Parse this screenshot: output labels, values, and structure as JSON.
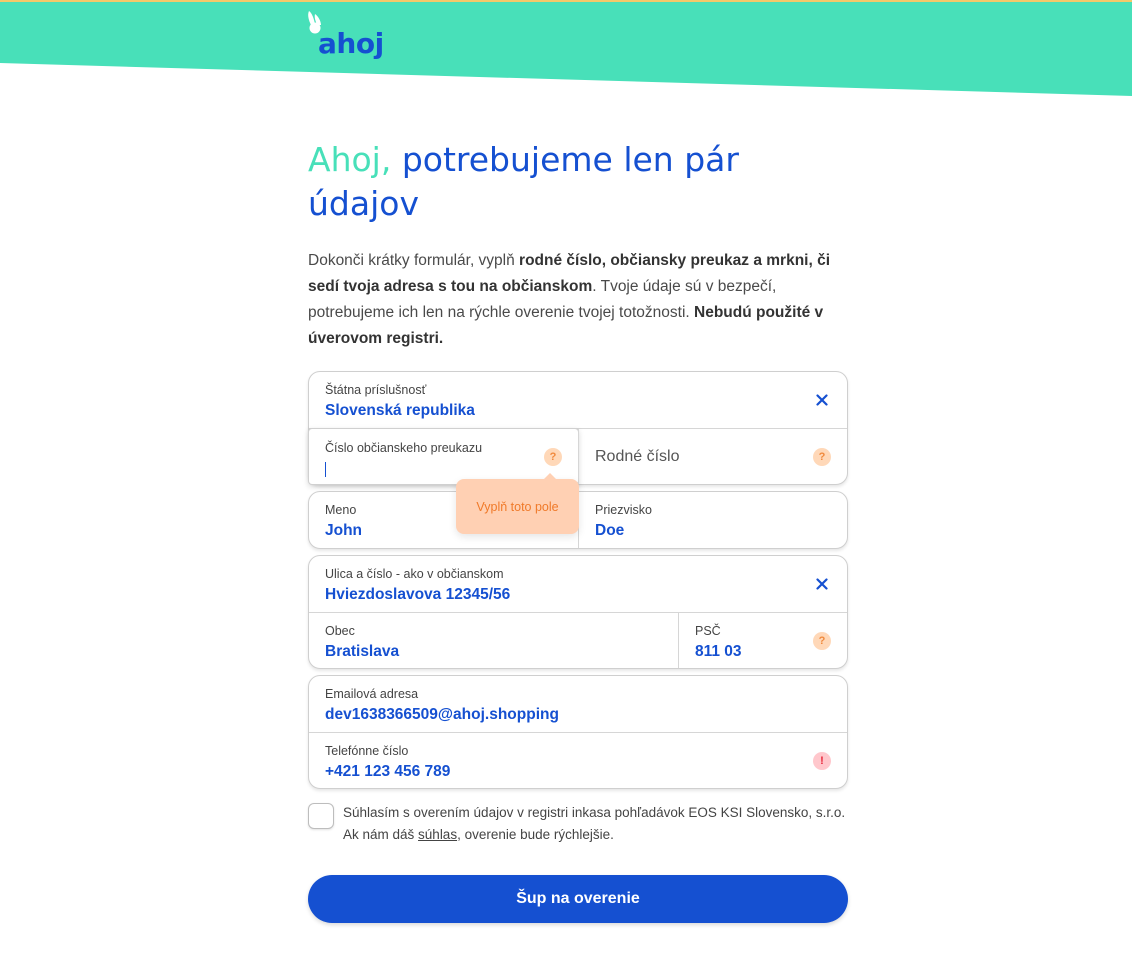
{
  "brand": {
    "name": "ahoj",
    "primary": "#1550d1",
    "accent": "#48e0b9"
  },
  "hero": {
    "greeting": "Ahoj,",
    "title": " potrebujeme len pár údajov"
  },
  "intro": {
    "p1": "Dokonči krátky formulár, vyplň ",
    "b1": "rodné číslo, občiansky preukaz a mrkni, či sedí tvoja adresa s tou na občianskom",
    "p2": ". Tvoje údaje sú v bezpečí, potrebujeme ich len na rýchle overenie tvojej totožnosti. ",
    "b2": "Nebudú použité v úverovom registri."
  },
  "form": {
    "nationality": {
      "label": "Štátna príslušnosť",
      "value": "Slovenská republika",
      "icon": "close-icon"
    },
    "id_card": {
      "label": "Číslo občianskeho preukazu",
      "value": "",
      "icon": "help-icon",
      "help_mark": "?"
    },
    "birth_number": {
      "placeholder": "Rodné číslo",
      "icon": "help-icon",
      "help_mark": "?"
    },
    "tooltip": "Vyplň toto pole",
    "first_name": {
      "label": "Meno",
      "value": "John"
    },
    "last_name": {
      "label": "Priezvisko",
      "value": "Doe"
    },
    "street": {
      "label": "Ulica a číslo - ako v občianskom",
      "value": "Hviezdoslavova 12345/56",
      "icon": "close-icon"
    },
    "city": {
      "label": "Obec",
      "value": "Bratislava"
    },
    "zip": {
      "label": "PSČ",
      "value": "811 03",
      "icon": "help-icon",
      "help_mark": "?"
    },
    "email": {
      "label": "Emailová adresa",
      "value": "dev1638366509@ahoj.shopping"
    },
    "phone": {
      "label": "Telefónne číslo",
      "value": "+421 123 456 789",
      "icon": "error-icon",
      "error_mark": "!"
    }
  },
  "consent": {
    "text_before": "Súhlasím s overením údajov v registri inkasa pohľadávok EOS KSI Slovensko, s.r.o. Ak nám dáš ",
    "link": "súhlas",
    "text_after": ", overenie bude rýchlejšie.",
    "checked": false
  },
  "submit_label": "Šup na overenie"
}
